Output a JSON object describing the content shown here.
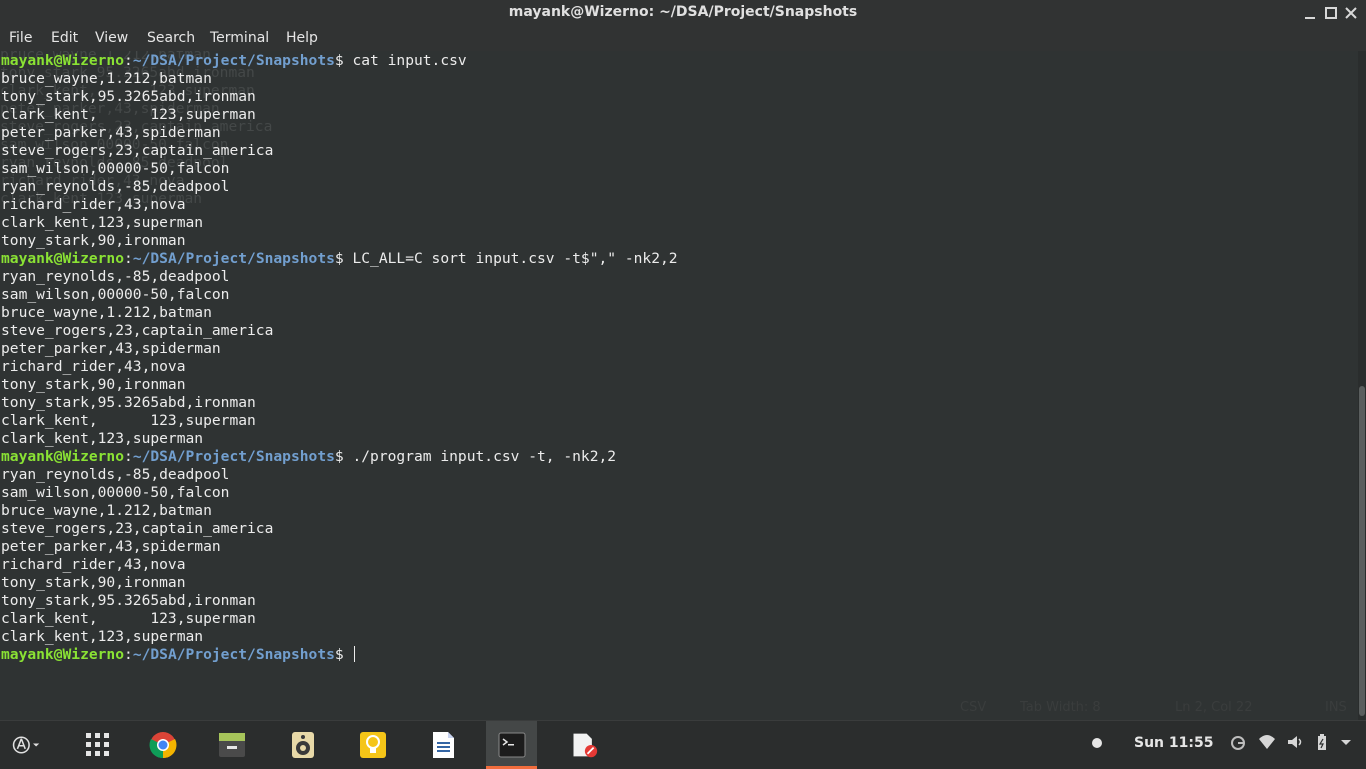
{
  "window": {
    "title": "mayank@Wizerno: ~/DSA/Project/Snapshots",
    "controls": [
      "minimize",
      "maximize",
      "close"
    ]
  },
  "menu": [
    "File",
    "Edit",
    "View",
    "Search",
    "Terminal",
    "Help"
  ],
  "prompt": {
    "user": "mayank@Wizerno",
    "separator": ":",
    "path": "~/DSA/Project/Snapshots",
    "symbol": "$ "
  },
  "terminal": {
    "blocks": [
      {
        "command": "cat input.csv",
        "output": [
          "bruce_wayne,1.212,batman",
          "tony_stark,95.3265abd,ironman",
          "clark_kent,      123,superman",
          "peter_parker,43,spiderman",
          "steve_rogers,23,captain_america",
          "sam_wilson,00000-50,falcon",
          "ryan_reynolds,-85,deadpool",
          "richard_rider,43,nova",
          "clark_kent,123,superman",
          "tony_stark,90,ironman"
        ]
      },
      {
        "command": "LC_ALL=C sort input.csv -t$\",\" -nk2,2",
        "output": [
          "ryan_reynolds,-85,deadpool",
          "sam_wilson,00000-50,falcon",
          "bruce_wayne,1.212,batman",
          "steve_rogers,23,captain_america",
          "peter_parker,43,spiderman",
          "richard_rider,43,nova",
          "tony_stark,90,ironman",
          "tony_stark,95.3265abd,ironman",
          "clark_kent,      123,superman",
          "clark_kent,123,superman"
        ]
      },
      {
        "command": "./program input.csv -t, -nk2,2",
        "output": [
          "ryan_reynolds,-85,deadpool",
          "sam_wilson,00000-50,falcon",
          "bruce_wayne,1.212,batman",
          "steve_rogers,23,captain_america",
          "peter_parker,43,spiderman",
          "richard_rider,43,nova",
          "tony_stark,90,ironman",
          "tony_stark,95.3265abd,ironman",
          "clark_kent,      123,superman",
          "clark_kent,123,superman"
        ]
      }
    ],
    "current_input": ""
  },
  "ghost_text": [
    "bruce_wayne,1.212,batman",
    "tony_stark,95.3265abd,ironman",
    "clark_kent,      123,superman",
    "peter_parker,43,spiderman",
    "steve_rogers,23,captain_america",
    "sam_wilson,00000-50,falcon",
    "ryan_reynolds,-85,deadpool",
    "richard_rider,43,nova",
    "clark_kent,123,superman"
  ],
  "ghost_status": {
    "syntax": "CSV",
    "tab_width": "Tab Width: 8",
    "position": "Ln 2, Col 22",
    "mode": "INS"
  },
  "taskbar": {
    "apps": [
      {
        "name": "Activities",
        "icon": "activities-icon",
        "active": false
      },
      {
        "name": "Show Applications",
        "icon": "app-grid-icon",
        "active": false
      },
      {
        "name": "Chrome",
        "icon": "chrome-icon",
        "active": false
      },
      {
        "name": "Files",
        "icon": "files-icon",
        "active": false
      },
      {
        "name": "Rhythmbox",
        "icon": "speaker-icon",
        "active": false
      },
      {
        "name": "Ideas",
        "icon": "lightbulb-icon",
        "active": false
      },
      {
        "name": "Text Editor",
        "icon": "document-icon",
        "active": false
      },
      {
        "name": "Terminal",
        "icon": "terminal-icon",
        "active": true
      },
      {
        "name": "Text Editor (edited)",
        "icon": "edit-document-icon",
        "active": false
      }
    ],
    "clock": "Sun 11:55"
  },
  "colors": {
    "terminal_bg": "#2f3333",
    "prompt_user": "#8ae234",
    "prompt_path": "#729fcf",
    "text": "#ececec",
    "accent": "#f26d3d"
  }
}
